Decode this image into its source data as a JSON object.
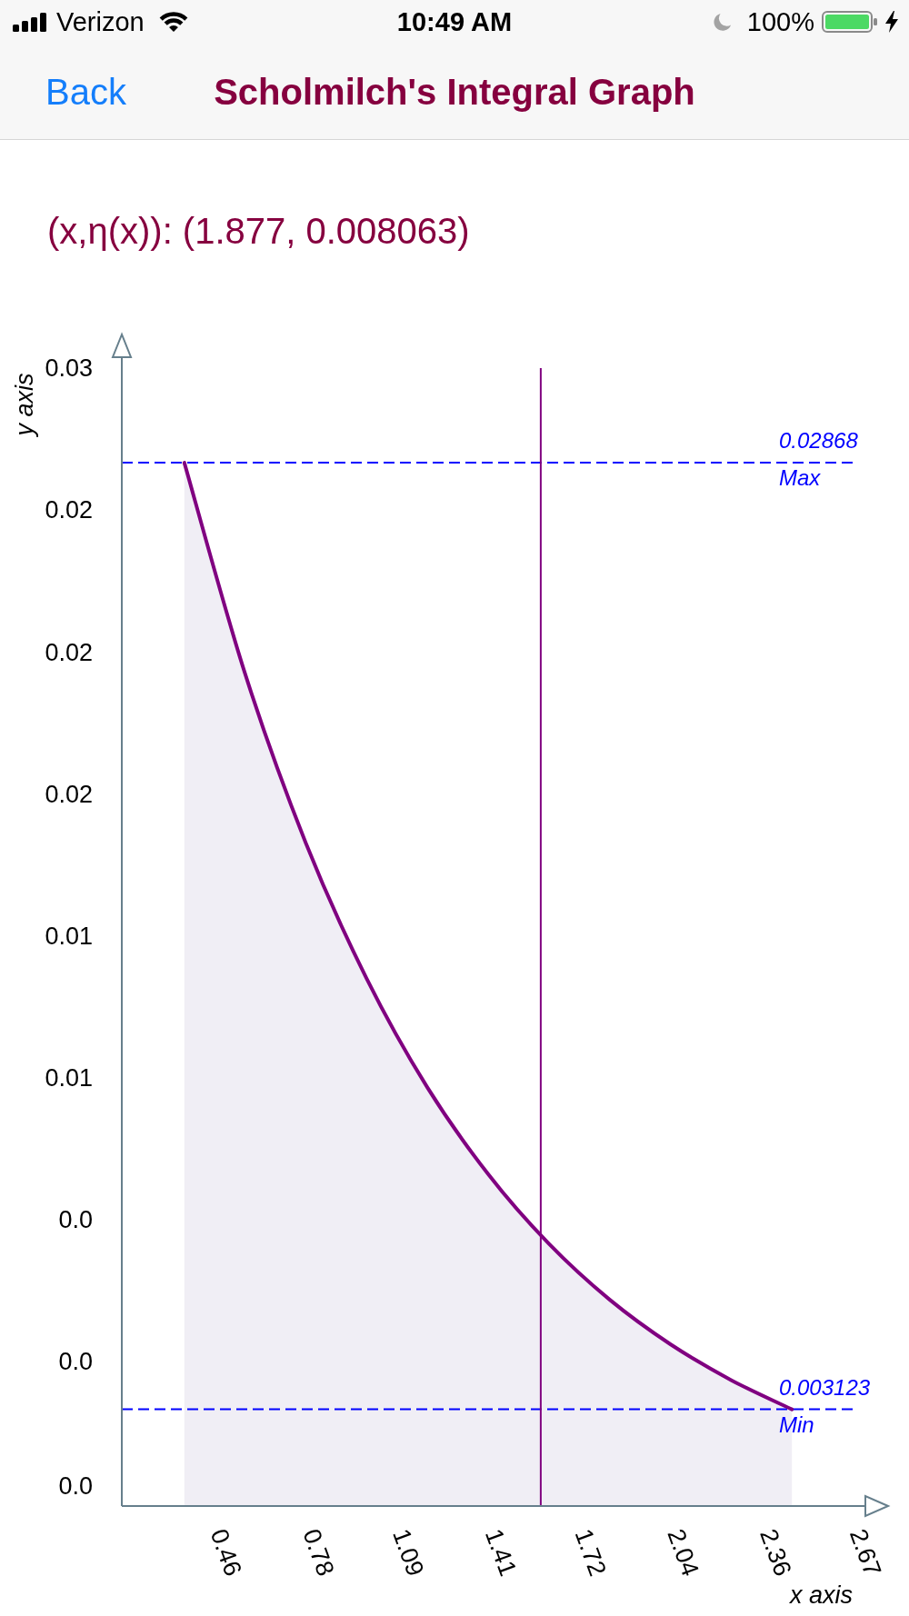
{
  "status_bar": {
    "carrier": "Verizon",
    "time": "10:49 AM",
    "battery": "100%"
  },
  "nav_bar": {
    "back": "Back",
    "title": "Scholmilch's Integral Graph"
  },
  "readout": "(x,η(x)): (1.877, 0.008063)",
  "graph": {
    "chart_data": {
      "type": "area",
      "xlabel": "x axis",
      "ylabel": "y axis",
      "x": [
        0.316,
        0.526,
        0.736,
        0.946,
        1.156,
        1.366,
        1.576,
        1.786,
        1.996,
        2.206,
        2.416
      ],
      "series": [
        {
          "color": "#800080",
          "values": [
            0.02563,
            0.02057,
            0.01651,
            0.01326,
            0.01065,
            0.00857,
            0.0069,
            0.00556,
            0.00449,
            0.00363,
            0.00293
          ]
        }
      ],
      "xlim": [
        0.1,
        2.67
      ],
      "ylim": [
        0.00061,
        0.02816
      ],
      "xticks": [
        0.46,
        0.78,
        1.09,
        1.41,
        1.72,
        2.04,
        2.36,
        2.67
      ],
      "yticks": [
        {
          "value": 0.0279,
          "label": "0.03"
        },
        {
          "value": 0.0245,
          "label": "0.02"
        },
        {
          "value": 0.02108,
          "label": "0.02"
        },
        {
          "value": 0.01768,
          "label": "0.02"
        },
        {
          "value": 0.01428,
          "label": "0.01"
        },
        {
          "value": 0.01088,
          "label": "0.01"
        },
        {
          "value": 0.00748,
          "label": "0.0"
        },
        {
          "value": 0.00408,
          "label": "0.0"
        },
        {
          "value": 0.00109,
          "label": "0.0"
        }
      ],
      "ref_lines": [
        {
          "axis": "y",
          "value": 0.02563,
          "label": "Max"
        },
        {
          "axis": "y",
          "value": 0.00293,
          "label": "Min"
        },
        {
          "axis": "x",
          "value": 1.548
        }
      ],
      "annotations": [
        "0.02868",
        "0.003123"
      ]
    }
  }
}
